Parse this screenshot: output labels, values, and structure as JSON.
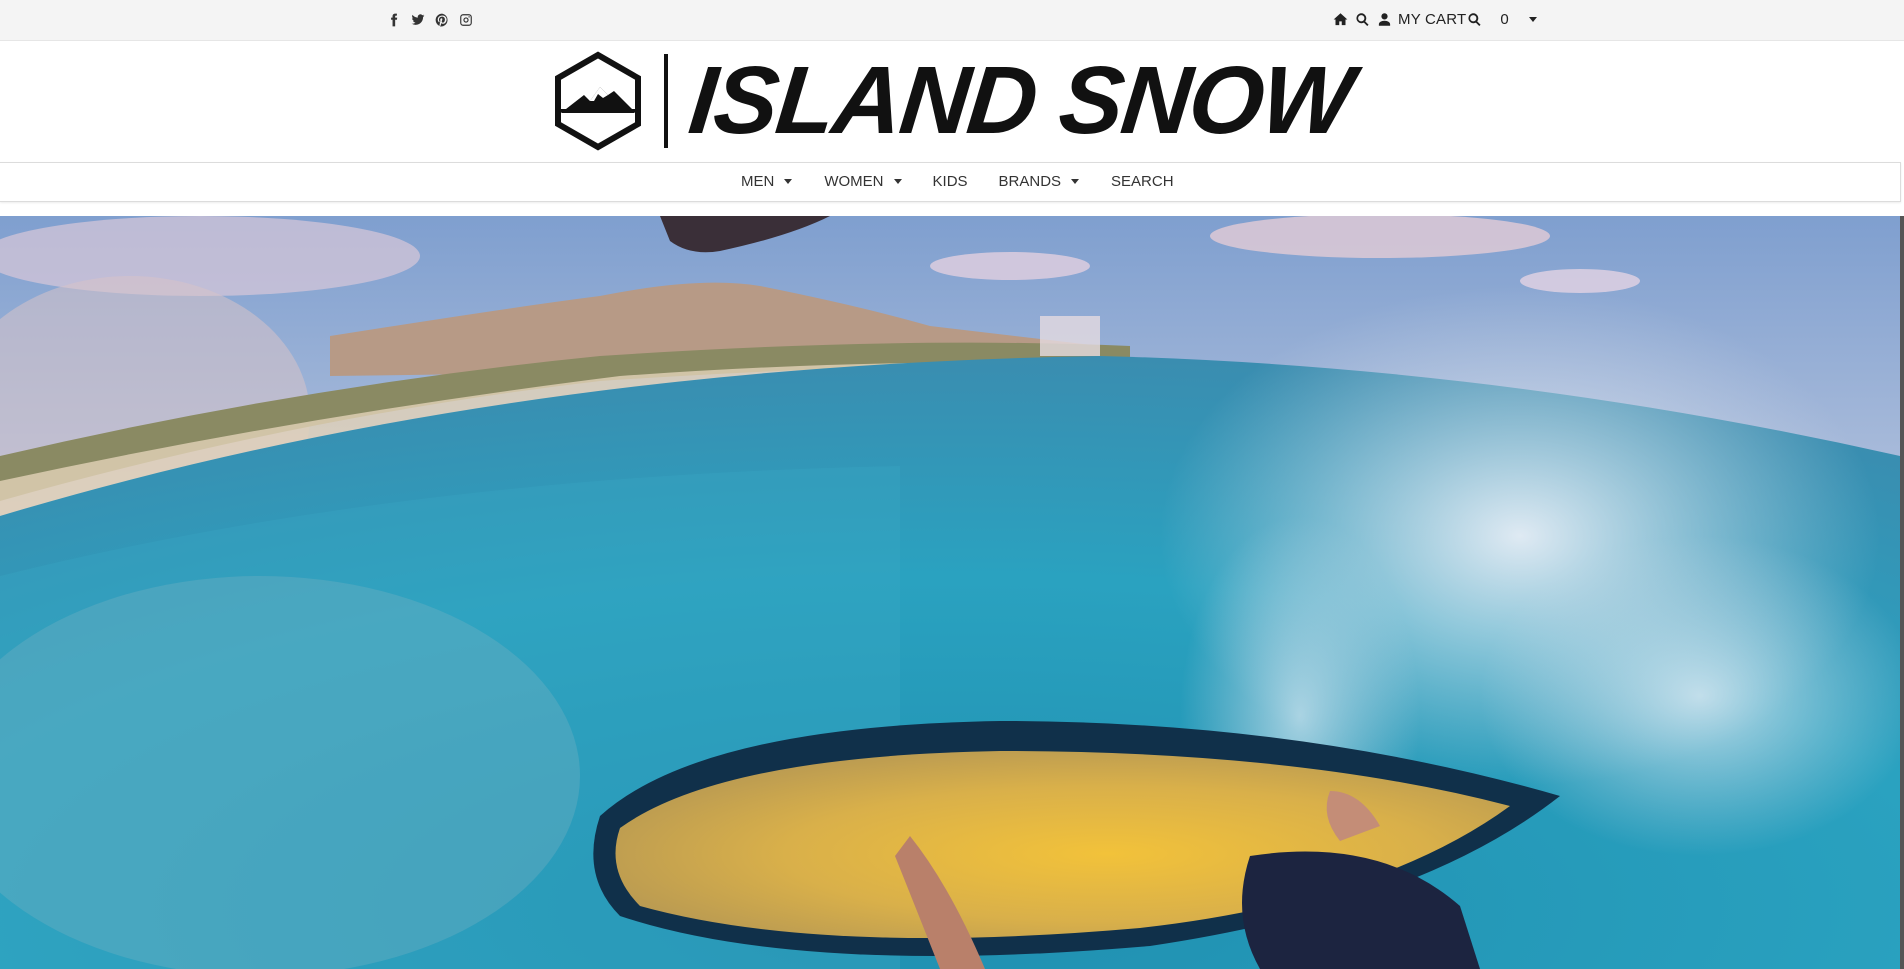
{
  "topbar": {
    "social_icons": [
      "facebook-icon",
      "twitter-icon",
      "pinterest-icon",
      "instagram-icon"
    ],
    "utility_icons": [
      "home-icon",
      "search-icon",
      "user-icon",
      "search-icon"
    ],
    "cart_label": "MY CART",
    "cart_count": "0"
  },
  "header": {
    "logo_text": "ISLAND SNOW",
    "logo_icon": "mountain-hexagon-icon"
  },
  "nav": {
    "items": [
      {
        "label": "MEN",
        "has_dropdown": true
      },
      {
        "label": "WOMEN",
        "has_dropdown": true
      },
      {
        "label": "KIDS",
        "has_dropdown": false
      },
      {
        "label": "BRANDS",
        "has_dropdown": true
      },
      {
        "label": "SEARCH",
        "has_dropdown": false
      }
    ]
  },
  "hero": {
    "scene": "surf-video-still",
    "colors": {
      "sky": "#8fb0d6",
      "water": "#2a9bb8",
      "board": "#e3b43a"
    }
  }
}
